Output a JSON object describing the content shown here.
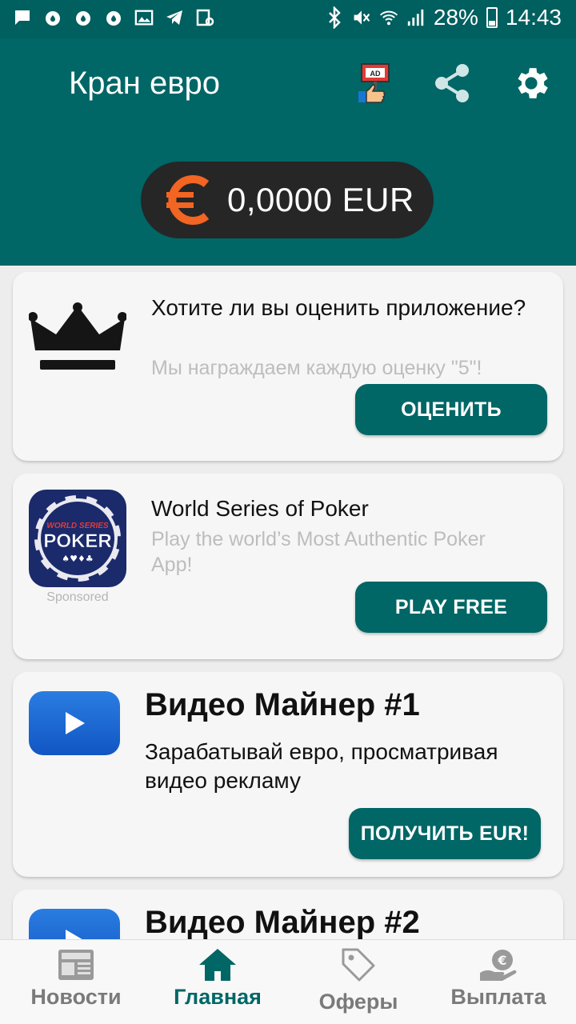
{
  "status_bar": {
    "battery": "28%",
    "time": "14:43"
  },
  "app_bar": {
    "title": "Кран евро",
    "ad_icon_text": "AD"
  },
  "balance": {
    "currency_symbol": "€",
    "amount": "0,0000 EUR"
  },
  "cards": [
    {
      "title": "Хотите ли вы оценить приложение?",
      "subtitle": "Мы награждаем каждую оценку \"5\"!",
      "button": "ОЦЕНИТЬ"
    },
    {
      "title": "World Series of Poker",
      "subtitle": "Play the world’s Most Authentic Poker App!",
      "sponsored": "Sponsored",
      "logo_top": "WORLD SERIES",
      "logo_main": "POKER",
      "button": "PLAY FREE"
    },
    {
      "title": "Видео Майнер #1",
      "subtitle": "Зарабатывай евро, просматривая видео рекламу",
      "button": "ПОЛУЧИТЬ EUR!"
    },
    {
      "title": "Видео Майнер #2"
    }
  ],
  "bottom_nav": [
    {
      "label": "Новости",
      "icon": "news-icon"
    },
    {
      "label": "Главная",
      "icon": "home-icon",
      "active": true
    },
    {
      "label": "Оферы",
      "icon": "tag-icon"
    },
    {
      "label": "Выплата",
      "icon": "payout-icon"
    }
  ],
  "colors": {
    "primary": "#006666",
    "status_bar": "#005f5f",
    "euro_orange": "#f26522",
    "pill": "#262626"
  }
}
